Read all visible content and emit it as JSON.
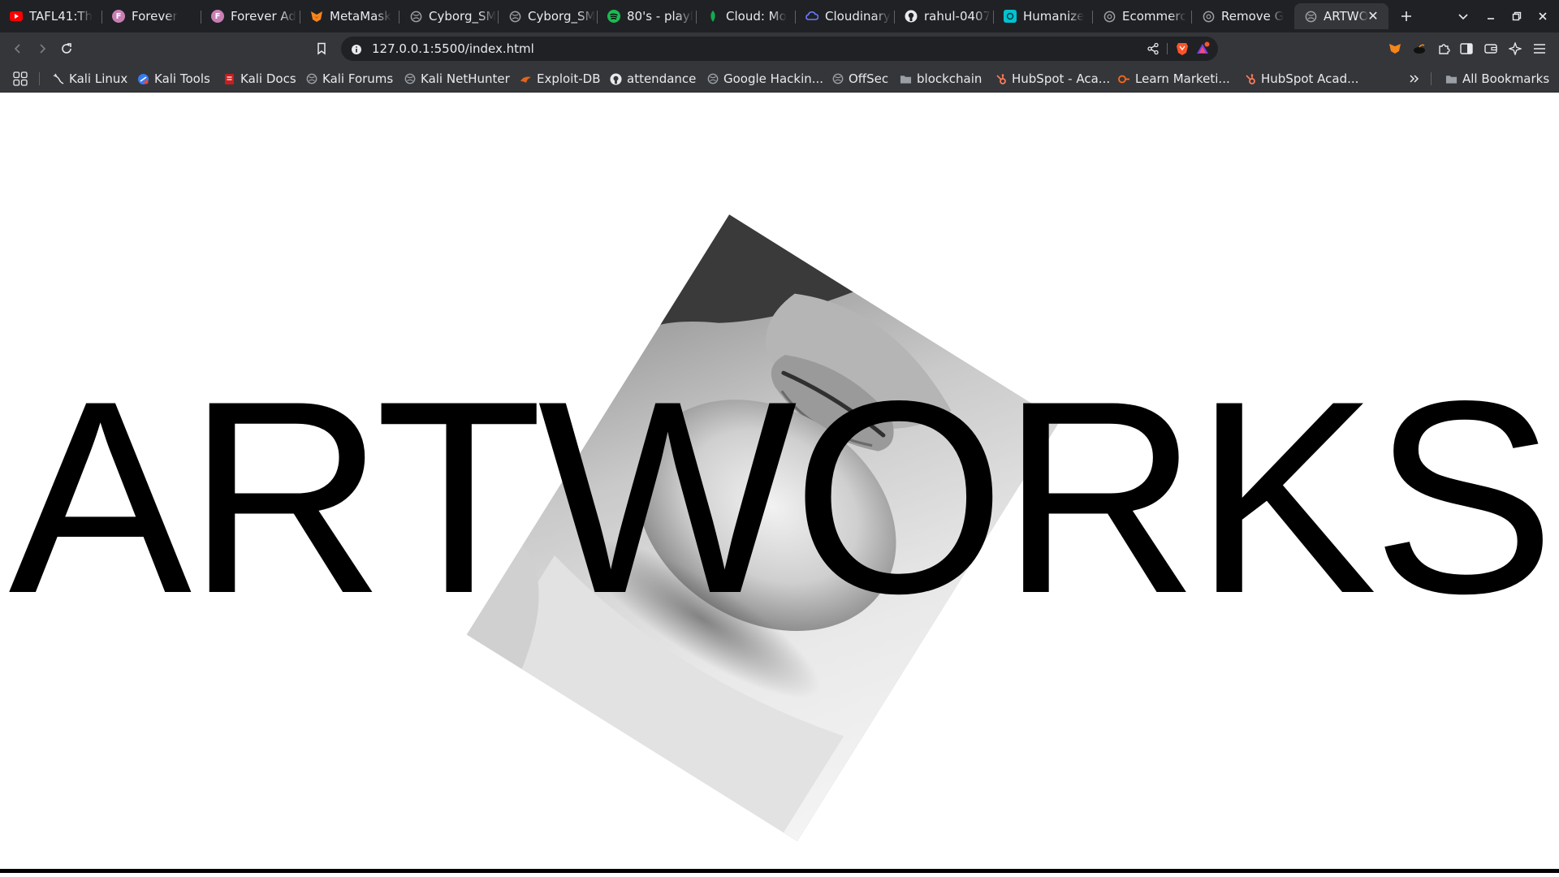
{
  "tabs": [
    {
      "label": "TAFL41:Th",
      "favicon": "youtube-icon",
      "color": "#ff0000"
    },
    {
      "label": "Forever",
      "favicon": "f-letter-icon",
      "color": "#c87fb4"
    },
    {
      "label": "Forever Ad",
      "favicon": "f-letter-icon",
      "color": "#c87fb4"
    },
    {
      "label": "MetaMask",
      "favicon": "fox-icon",
      "color": "#f6851b"
    },
    {
      "label": "Cyborg_SM",
      "favicon": "globe-icon",
      "color": "#9aa0a6"
    },
    {
      "label": "Cyborg_SM",
      "favicon": "globe-icon",
      "color": "#9aa0a6"
    },
    {
      "label": "80's - playl",
      "favicon": "spotify-icon",
      "color": "#1db954"
    },
    {
      "label": "Cloud: Mo",
      "favicon": "leaf-icon",
      "color": "#13aa52"
    },
    {
      "label": "Cloudinary",
      "favicon": "cloud-icon",
      "color": "#3448c5"
    },
    {
      "label": "rahul-0407",
      "favicon": "github-icon",
      "color": "#e8eaed"
    },
    {
      "label": "Humanize",
      "favicon": "humanize-icon",
      "color": "#00c2d1"
    },
    {
      "label": "Ecommerc",
      "favicon": "globe-icon",
      "color": "#9aa0a6"
    },
    {
      "label": "Remove G",
      "favicon": "globe-icon",
      "color": "#9aa0a6"
    },
    {
      "label": "ARTWO",
      "favicon": "globe-icon",
      "color": "#9aa0a6",
      "active": true
    }
  ],
  "toolbar": {
    "url": "127.0.0.1:5500/index.html"
  },
  "bookmarks": [
    {
      "label": "Kali Linux",
      "icon": "kali-dragon-icon"
    },
    {
      "label": "Kali Tools",
      "icon": "kali-tools-icon"
    },
    {
      "label": "Kali Docs",
      "icon": "kali-docs-icon"
    },
    {
      "label": "Kali Forums",
      "icon": "globe-icon"
    },
    {
      "label": "Kali NetHunter",
      "icon": "globe-icon"
    },
    {
      "label": "Exploit-DB",
      "icon": "exploit-db-icon"
    },
    {
      "label": "attendance",
      "icon": "github-icon"
    },
    {
      "label": "Google Hackin...",
      "icon": "globe-icon"
    },
    {
      "label": "OffSec",
      "icon": "globe-icon"
    },
    {
      "label": "blockchain",
      "icon": "folder-icon"
    },
    {
      "label": "HubSpot - Aca...",
      "icon": "hubspot-icon"
    },
    {
      "label": "Learn Marketi...",
      "icon": "learn-marketing-icon"
    },
    {
      "label": "HubSpot Acad...",
      "icon": "hubspot-icon"
    }
  ],
  "all_bookmarks": "All Bookmarks",
  "page": {
    "hero_title": "ARTWORKS",
    "image_alt": "black and white sculpture close-up of lips and chin"
  },
  "colors": {
    "tabstrip_bg": "#202124",
    "toolbar_bg": "#35363a",
    "page_bg": "#ffffff",
    "title_color": "#000000",
    "brave_accent": "#fb542b"
  }
}
